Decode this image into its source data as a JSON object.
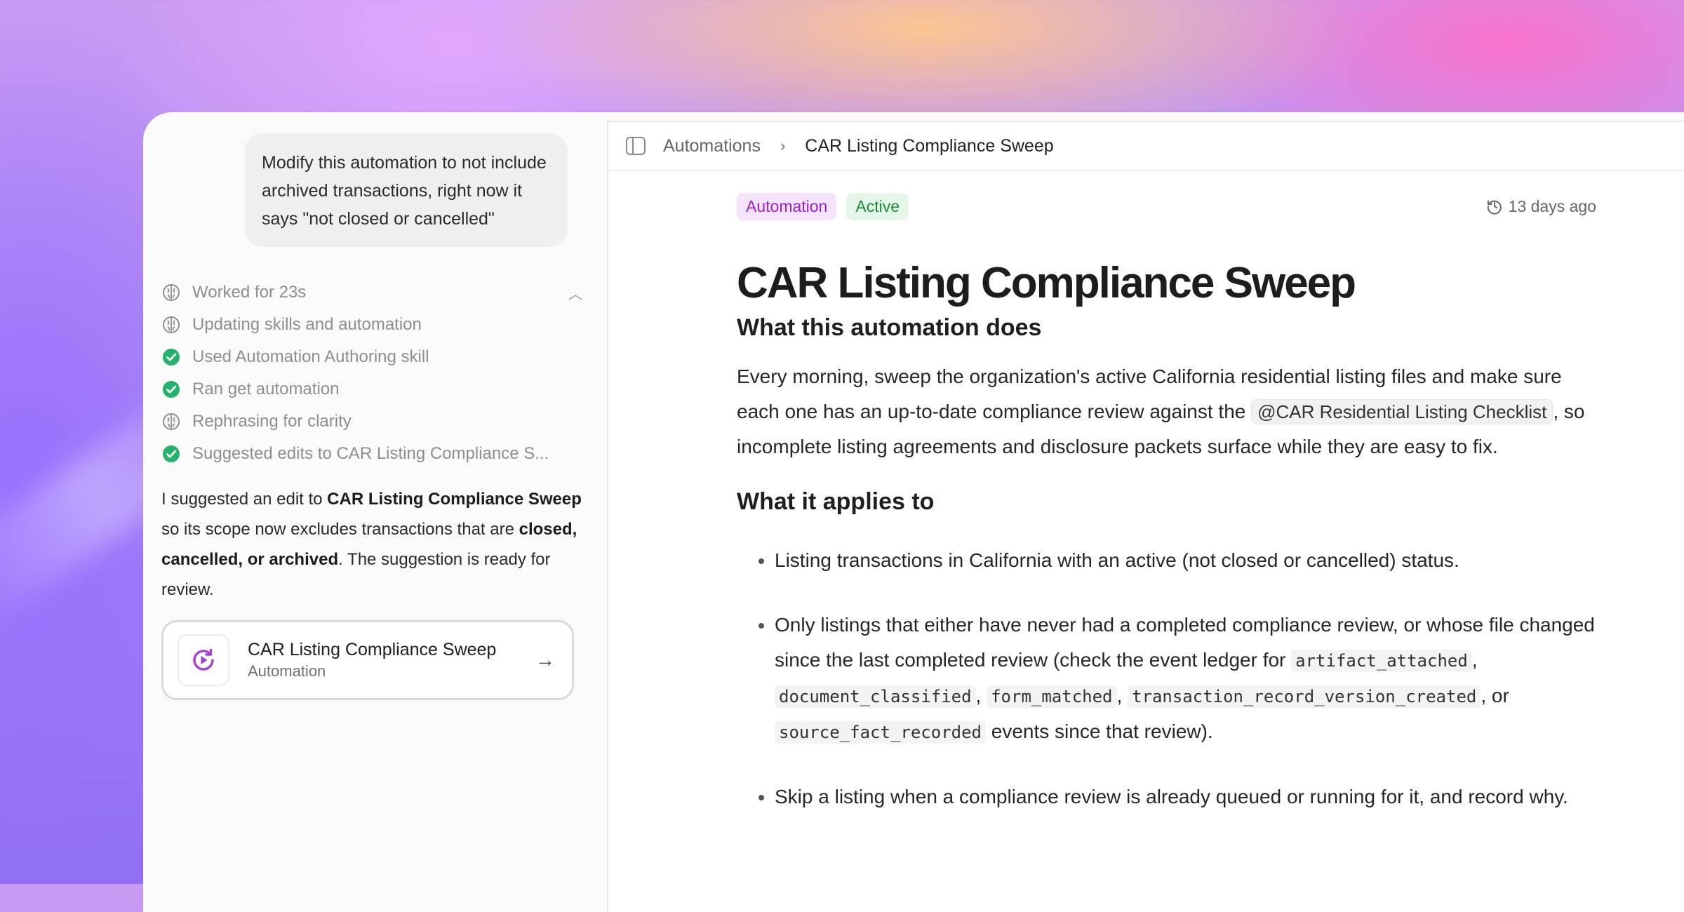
{
  "chat": {
    "user_message": "Modify this automation to not include archived transactions, right now it says \"not closed or cancelled\"",
    "steps": [
      {
        "label": "Worked for 23s",
        "icon": "brain-icon",
        "state": "thinking"
      },
      {
        "label": "Updating skills and automation",
        "icon": "brain-icon",
        "state": "thinking"
      },
      {
        "label": "Used Automation Authoring skill",
        "icon": "check-circle-icon",
        "state": "done"
      },
      {
        "label": "Ran get automation",
        "icon": "check-circle-icon",
        "state": "done"
      },
      {
        "label": "Rephrasing for clarity",
        "icon": "brain-icon",
        "state": "thinking"
      },
      {
        "label": "Suggested edits to CAR Listing Compliance S...",
        "icon": "check-circle-icon",
        "state": "done"
      }
    ],
    "reply": {
      "t1": "I suggested an edit to ",
      "b1": "CAR Listing Compliance Sweep",
      "t2": " so its scope now excludes transactions that are ",
      "b2": "closed, cancelled, or archived",
      "t3": ". The suggestion is ready for review."
    },
    "card": {
      "title": "CAR Listing Compliance Sweep",
      "subtitle": "Automation",
      "icon": "automation-refresh-icon"
    }
  },
  "breadcrumb": {
    "parent": "Automations",
    "current": "CAR Listing Compliance Sweep"
  },
  "doc": {
    "tags": {
      "type": "Automation",
      "status": "Active"
    },
    "updated": "13 days ago",
    "title": "CAR Listing Compliance Sweep",
    "section1": {
      "heading": "What this automation does",
      "p_before": "Every morning, sweep the organization's active California residential listing files and make sure each one has an up-to-date compliance review against the ",
      "mention": "@CAR Residential Listing Checklist",
      "p_after": ", so incomplete listing agreements and disclosure packets surface while they are easy to fix."
    },
    "section2": {
      "heading": "What it applies to",
      "bullet1": "Listing transactions in California with an active (not closed or cancelled) status.",
      "bullet2": {
        "t1": "Only listings that either have never had a completed compliance review, or whose file changed since the last completed review (check the event ledger for ",
        "c1": "artifact_attached",
        "t2": ", ",
        "c2": "document_classified",
        "t3": ", ",
        "c3": "form_matched",
        "t4": ", ",
        "c4": "transaction_record_version_created",
        "t5": ", or ",
        "c5": "source_fact_recorded",
        "t6": " events since that review)."
      },
      "bullet3": "Skip a listing when a compliance review is already queued or running for it, and record why."
    }
  },
  "colors": {
    "accent_purple": "#9a22c9",
    "success_green": "#22b26a",
    "tag_green_text": "#1d8a3e"
  }
}
